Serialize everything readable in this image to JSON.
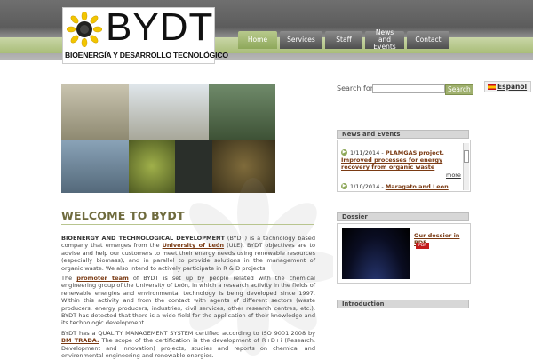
{
  "header": {
    "logo_text": "BYDT",
    "logo_subtitle": "BIOENERGÍA Y DESARROLLO TECNOLÓGICO",
    "nav": [
      {
        "label": "Home",
        "active": true
      },
      {
        "label": "Services",
        "active": false
      },
      {
        "label": "Staff",
        "active": false
      },
      {
        "label": "News and Events",
        "active": false
      },
      {
        "label": "Contact",
        "active": false
      }
    ]
  },
  "search": {
    "label": "Search for:",
    "value": "",
    "button": "Search"
  },
  "language": {
    "label": "Español"
  },
  "news": {
    "title": "News and Events",
    "items": [
      {
        "date": "1/11/2014",
        "link": "PLAMGAS project. Improved processes for energy recovery from organic waste"
      },
      {
        "date": "1/10/2014",
        "link": "Maragato and Leon talent in a"
      }
    ],
    "more": "more"
  },
  "dossier": {
    "title": "Dossier",
    "link": "Our dossier in PDF",
    "badge": "PDF"
  },
  "introduction": {
    "title": "Introduction"
  },
  "main": {
    "title": "WELCOME TO BYDT",
    "p1_strong": "BIOENERGY AND TECHNOLOGICAL DEVELOPMENT",
    "p1_a": " (BYDT) is a technology based company that emerges from the ",
    "p1_link": "University of León",
    "p1_b": " (ULE). BYDT objectives are to advise and help our customers to meet their energy needs using renewable resources (especially biomass), and in parallel to provide solutions in the management of organic waste. We also intend to actively participate in R & D projects.",
    "p2_a": "The ",
    "p2_link": "promoter team",
    "p2_b": " of BYDT is set up by people related with the chemical engineering group of the University of León, in which a research activity in the fields of renewable energies and environmental technology is being developed since 1997. Within this activity and from the contact with agents of different sectors (waste producers, energy producers, industries, civil services, other research centres, etc.), BYDT has detected that there is a wide field for the application of their knowledge and its technologic development.",
    "p3_a": "BYDT has a QUALITY MANAGEMENT SYSTEM certified according to ISO 9001:2008 by",
    "p3_link": "BM TRADA.",
    "p3_b": " The scope of the certification is the development of R+D+i (Research, Development and Innovation) projects, studies and reports on chemical and environmental engineering and renewable energies."
  },
  "colors": {
    "accent_green": "#8ea85a",
    "title_olive": "#6e6a3d",
    "link_brown": "#7a3a13"
  }
}
